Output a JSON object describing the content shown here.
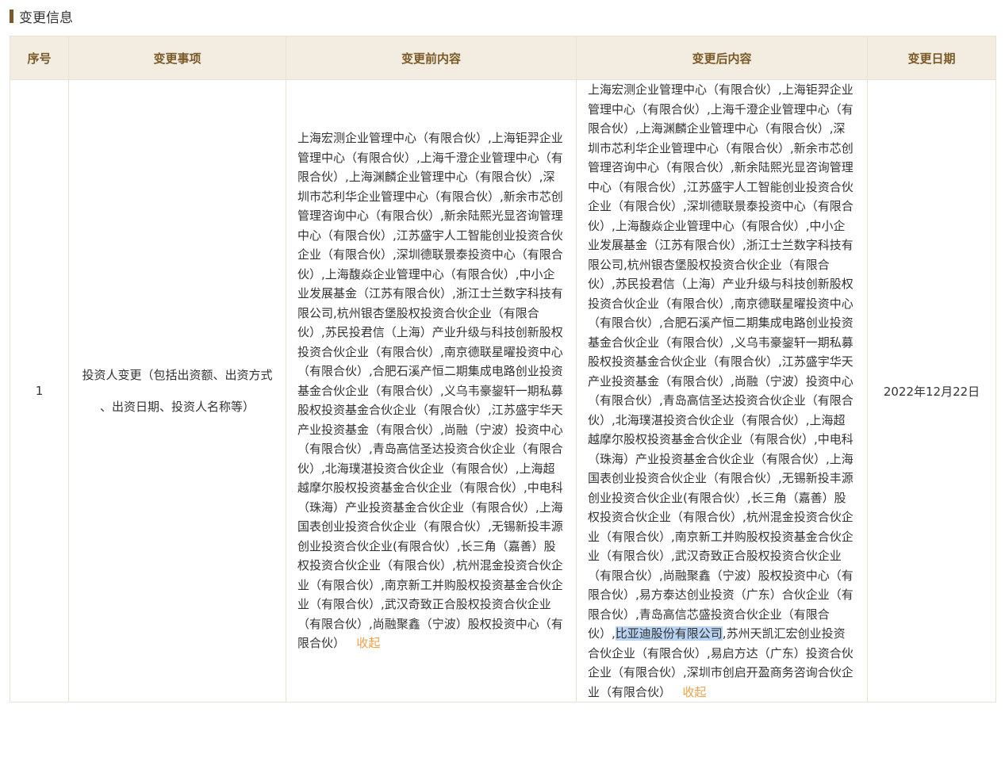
{
  "section": {
    "title": "变更信息"
  },
  "table": {
    "headers": {
      "index": "序号",
      "item": "变更事项",
      "before": "变更前内容",
      "after": "变更后内容",
      "date": "变更日期"
    },
    "rows": [
      {
        "index": "1",
        "item_line1": "投资人变更（包括出资额、出资方式",
        "item_line2": "、出资日期、投资人名称等）",
        "before": "上海宏测企业管理中心（有限合伙）,上海钜羿企业管理中心（有限合伙）,上海千澄企业管理中心（有限合伙）,上海渊麟企业管理中心（有限合伙）,深圳市芯利华企业管理中心（有限合伙）,新余市芯创管理咨询中心（有限合伙）,新余陆熙光显咨询管理中心（有限合伙）,江苏盛宇人工智能创业投资合伙企业（有限合伙）,深圳德联景泰投资中心（有限合伙）,上海馥焱企业管理中心（有限合伙）,中小企业发展基金（江苏有限合伙）,浙江士兰数字科技有限公司,杭州银杏堡股权投资合伙企业（有限合伙）,苏民投君信（上海）产业升级与科技创新股权投资合伙企业（有限合伙）,南京德联星曜投资中心（有限合伙）,合肥石溪产恒二期集成电路创业投资基金合伙企业（有限合伙）,义乌韦豪鋆轩一期私募股权投资基金合伙企业（有限合伙）,江苏盛宇华天产业投资基金（有限合伙）,尚融（宁波）投资中心（有限合伙）,青岛高信圣达投资合伙企业（有限合伙）,北海璞湛投资合伙企业（有限合伙）,上海超越摩尔股权投资基金合伙企业（有限合伙）,中电科（珠海）产业投资基金合伙企业（有限合伙）,上海国表创业投资合伙企业（有限合伙）,无锡新投丰源创业投资合伙企业(有限合伙）,长三角（嘉善）股权投资合伙企业（有限合伙）,杭州混金投资合伙企业（有限合伙）,南京新工并购股权投资基金合伙企业（有限合伙）,武汉奇致正合股权投资合伙企业（有限合伙）,尚融聚鑫（宁波）股权投资中心（有限合伙）",
        "after_part1": "上海宏测企业管理中心（有限合伙）,上海钜羿企业管理中心（有限合伙）,上海千澄企业管理中心（有限合伙）,上海渊麟企业管理中心（有限合伙）,深圳市芯利华企业管理中心（有限合伙）,新余市芯创管理咨询中心（有限合伙）,新余陆熙光显咨询管理中心（有限合伙）,江苏盛宇人工智能创业投资合伙企业（有限合伙）,深圳德联景泰投资中心（有限合伙）,上海馥焱企业管理中心（有限合伙）,中小企业发展基金（江苏有限合伙）,浙江士兰数字科技有限公司,杭州银杏堡股权投资合伙企业（有限合伙）,苏民投君信（上海）产业升级与科技创新股权投资合伙企业（有限合伙）,南京德联星曜投资中心（有限合伙）,合肥石溪产恒二期集成电路创业投资基金合伙企业（有限合伙）,义乌韦豪鋆轩一期私募股权投资基金合伙企业（有限合伙）,江苏盛宇华天产业投资基金（有限合伙）,尚融（宁波）投资中心（有限合伙）,青岛高信圣达投资合伙企业（有限合伙）,北海璞湛投资合伙企业（有限合伙）,上海超越摩尔股权投资基金合伙企业（有限合伙）,中电科（珠海）产业投资基金合伙企业（有限合伙）,上海国表创业投资合伙企业（有限合伙）,无锡新投丰源创业投资合伙企业(有限合伙）,长三角（嘉善）股权投资合伙企业（有限合伙）,杭州混金投资合伙企业（有限合伙）,南京新工并购股权投资基金合伙企业（有限合伙）,武汉奇致正合股权投资合伙企业（有限合伙）,尚融聚鑫（宁波）股权投资中心（有限合伙）,易方泰达创业投资（广东）合伙企业（有限合伙）,青岛高信芯盛投资合伙企业（有限合伙）,",
        "after_highlight": "比亚迪股份有限公司",
        "after_part2": ",苏州天凯汇宏创业投资合伙企业（有限合伙）,易启方达（广东）投资合伙企业（有限合伙）,深圳市创启开盈商务咨询合伙企业（有限合伙）",
        "collapse_label": "收起",
        "date": "2022年12月22日"
      }
    ]
  }
}
